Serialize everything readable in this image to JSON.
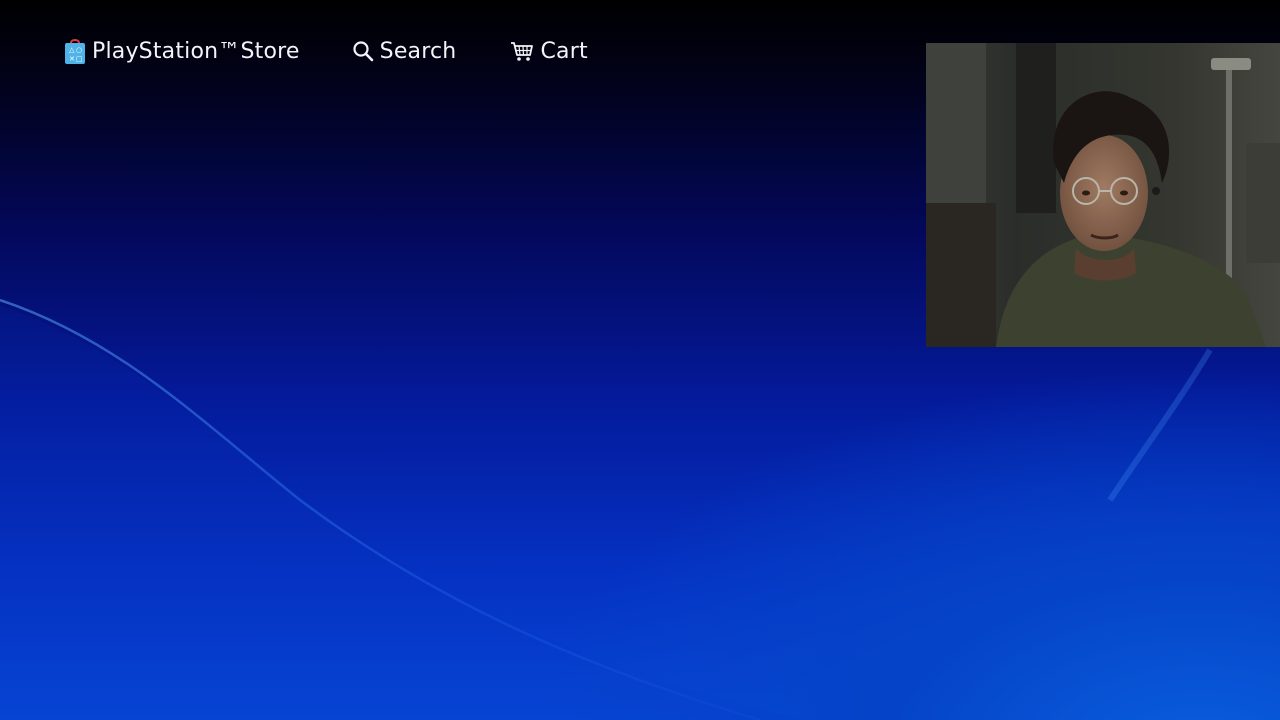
{
  "nav": {
    "store_label": "PlayStation™Store",
    "search_label": "Search",
    "cart_label": "Cart"
  },
  "icons": {
    "store": "playstation-store-bag-icon",
    "search": "search-icon",
    "cart": "cart-icon"
  },
  "colors": {
    "background_top": "#000000",
    "background_bottom": "#0646d6",
    "nav_text": "#f2f4f8",
    "store_bag": "#4fb3e8"
  },
  "camera": {
    "description_visible": false
  }
}
